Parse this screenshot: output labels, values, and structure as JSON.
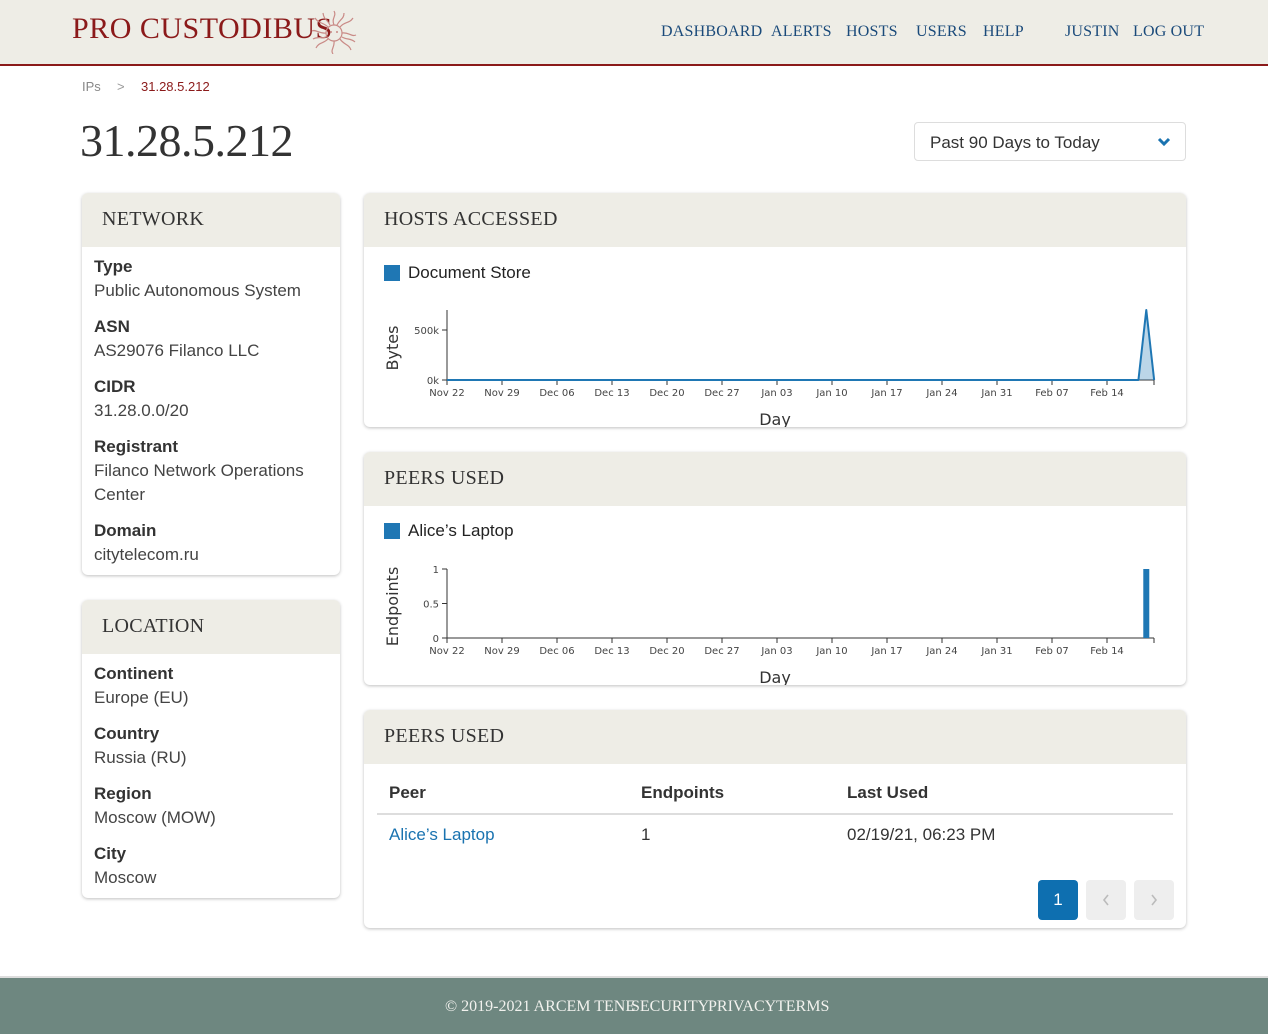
{
  "header": {
    "brand": "PRO CUSTODIBUS",
    "brand_icon": "medusa-head-icon",
    "nav": [
      "DASHBOARD",
      "ALERTS",
      "HOSTS",
      "USERS",
      "HELP"
    ],
    "user": "JUSTIN",
    "logout": "LOG OUT"
  },
  "breadcrumb": {
    "parent": "IPs",
    "separator": ">",
    "current": "31.28.5.212"
  },
  "page_title": "31.28.5.212",
  "range_select": {
    "value": "Past 90 Days to Today",
    "icon": "chevron-down-icon"
  },
  "network": {
    "title": "NETWORK",
    "fields": [
      {
        "label": "Type",
        "value": "Public Autonomous System"
      },
      {
        "label": "ASN",
        "value": "AS29076 Filanco LLC"
      },
      {
        "label": "CIDR",
        "value": "31.28.0.0/20"
      },
      {
        "label": "Registrant",
        "value": "Filanco Network Operations Center"
      },
      {
        "label": "Domain",
        "value": "citytelecom.ru"
      }
    ]
  },
  "location": {
    "title": "LOCATION",
    "fields": [
      {
        "label": "Continent",
        "value": "Europe (EU)"
      },
      {
        "label": "Country",
        "value": "Russia (RU)"
      },
      {
        "label": "Region",
        "value": "Moscow (MOW)"
      },
      {
        "label": "City",
        "value": "Moscow"
      }
    ]
  },
  "hosts_accessed": {
    "title": "HOSTS ACCESSED"
  },
  "peers_chart": {
    "title": "PEERS USED"
  },
  "chart_data": [
    {
      "type": "area",
      "title": "HOSTS ACCESSED",
      "legend": [
        "Document Store"
      ],
      "legend_position": "top-left",
      "xlabel": "Day",
      "ylabel": "Bytes",
      "x_ticks": [
        "Nov 22",
        "Nov 29",
        "Dec 06",
        "Dec 13",
        "Dec 20",
        "Dec 27",
        "Jan 03",
        "Jan 10",
        "Jan 17",
        "Jan 24",
        "Jan 31",
        "Feb 07",
        "Feb 14"
      ],
      "y_ticks": [
        "0k",
        "500k"
      ],
      "ylim": [
        0,
        700000
      ],
      "series": [
        {
          "name": "Document Store",
          "color": "#1f77b4",
          "points": [
            {
              "x": "Nov 22",
              "y": 0
            },
            {
              "x": "Feb 17",
              "y": 0
            },
            {
              "x": "Feb 18",
              "y": 0
            },
            {
              "x": "Feb 19",
              "y": 700000
            },
            {
              "x": "Feb 20",
              "y": 0
            }
          ]
        }
      ]
    },
    {
      "type": "bar",
      "title": "PEERS USED",
      "legend": [
        "Alice’s Laptop"
      ],
      "legend_position": "top-left",
      "xlabel": "Day",
      "ylabel": "Endpoints",
      "x_ticks": [
        "Nov 22",
        "Nov 29",
        "Dec 06",
        "Dec 13",
        "Dec 20",
        "Dec 27",
        "Jan 03",
        "Jan 10",
        "Jan 17",
        "Jan 24",
        "Jan 31",
        "Feb 07",
        "Feb 14"
      ],
      "y_ticks": [
        "0",
        "0.5",
        "1"
      ],
      "ylim": [
        0,
        1
      ],
      "series": [
        {
          "name": "Alice’s Laptop",
          "color": "#1f77b4",
          "points": [
            {
              "x": "Feb 19",
              "y": 1
            }
          ]
        }
      ]
    }
  ],
  "peers_table": {
    "title": "PEERS USED",
    "columns": [
      "Peer",
      "Endpoints",
      "Last Used"
    ],
    "rows": [
      {
        "peer": "Alice’s Laptop",
        "endpoints": "1",
        "last_used": "02/19/21, 06:23 PM"
      }
    ],
    "pagination": {
      "current": "1",
      "prev_icon": "chevron-left-icon",
      "next_icon": "chevron-right-icon"
    }
  },
  "footer": {
    "copyright": "© 2019-2021 ARCEM TENE",
    "links": [
      "SECURITY",
      "PRIVACY",
      "TERMS"
    ]
  }
}
